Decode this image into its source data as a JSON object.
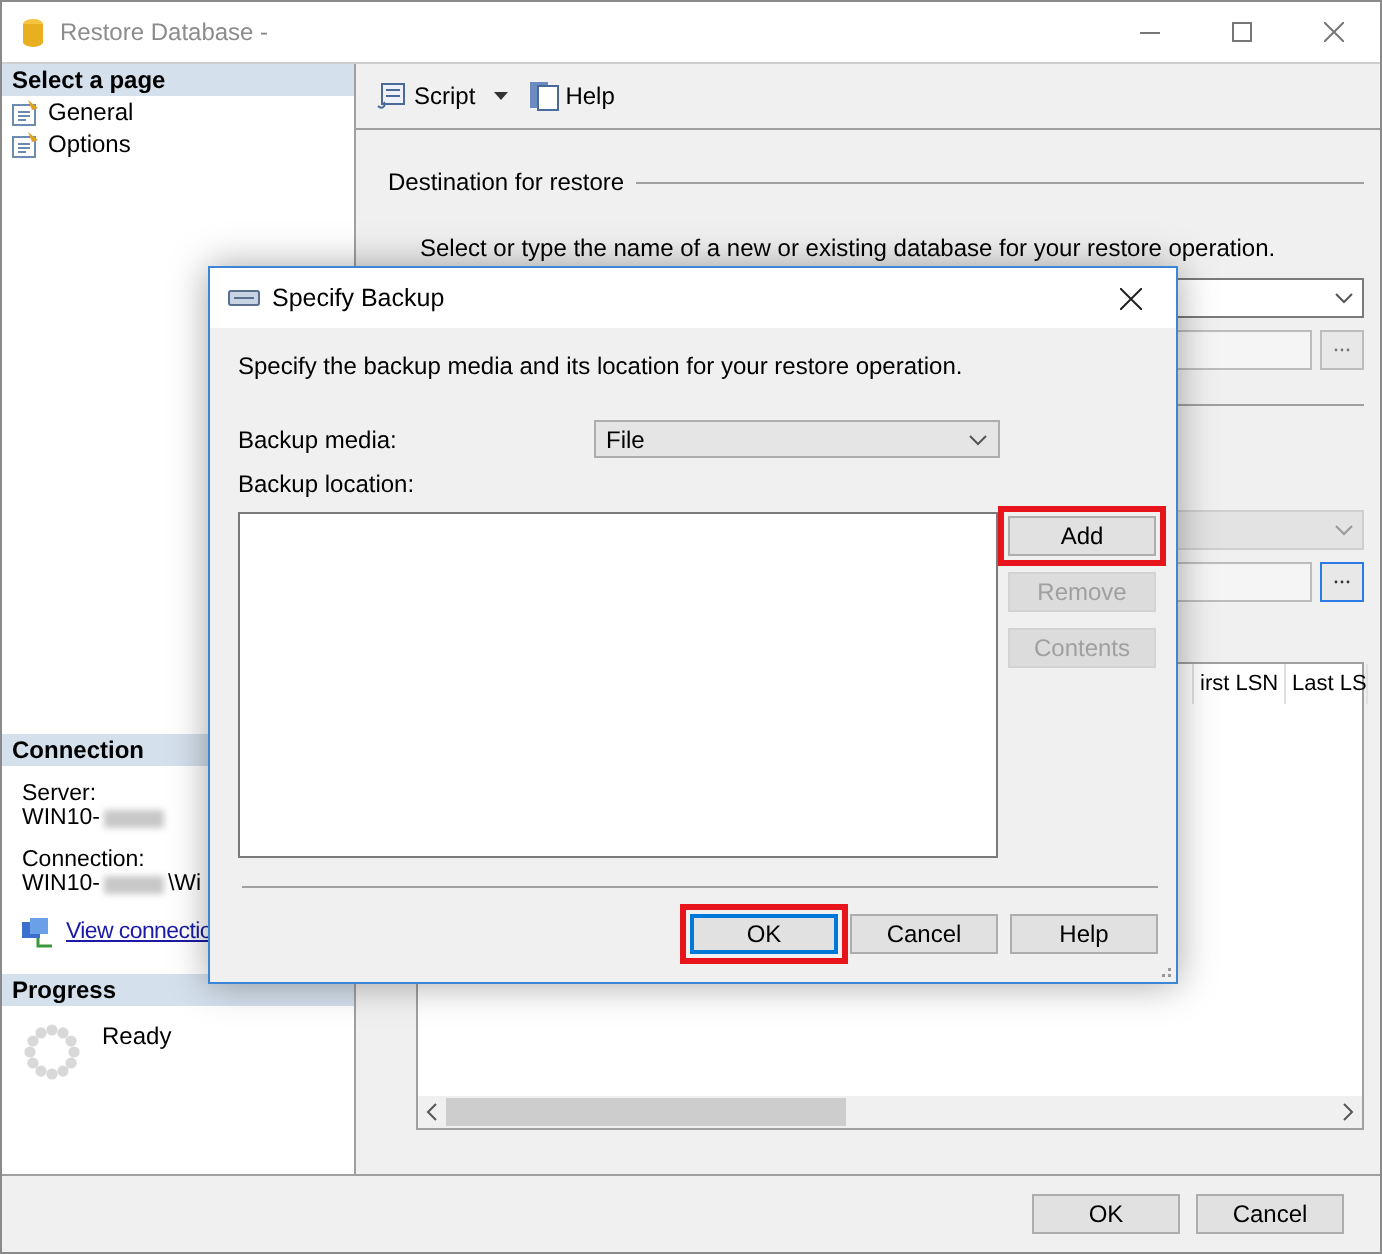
{
  "window": {
    "title": "Restore Database -"
  },
  "sidebar": {
    "header": "Select a page",
    "pages": [
      {
        "label": "General"
      },
      {
        "label": "Options"
      }
    ]
  },
  "connection": {
    "header": "Connection",
    "server_label": "Server:",
    "server_value": "WIN10-",
    "connection_label": "Connection:",
    "connection_value_prefix": "WIN10-",
    "connection_value_suffix": "\\Wi",
    "link": "View connectio"
  },
  "progress": {
    "header": "Progress",
    "status": "Ready"
  },
  "toolbar": {
    "items": [
      {
        "label": "Script",
        "kind": "dropdown"
      },
      {
        "label": "Help",
        "kind": "help"
      }
    ]
  },
  "destination": {
    "legend": "Destination for restore",
    "instruction": "Select or type the name of a new or existing database for your restore operation."
  },
  "grid": {
    "columns": [
      "irst LSN",
      "Last LS"
    ]
  },
  "footer_buttons": [
    "OK",
    "Cancel"
  ],
  "dialog": {
    "title": "Specify Backup",
    "description": "Specify the backup media and its location for your restore operation.",
    "media_label": "Backup media:",
    "media_value": "File",
    "location_label": "Backup location:",
    "side_buttons": [
      {
        "label": "Add",
        "disabled": false,
        "highlighted": true
      },
      {
        "label": "Remove",
        "disabled": true,
        "highlighted": false
      },
      {
        "label": "Contents",
        "disabled": true,
        "highlighted": false
      }
    ],
    "buttons": [
      {
        "label": "OK",
        "highlighted": true,
        "default": true
      },
      {
        "label": "Cancel",
        "highlighted": false,
        "default": false
      },
      {
        "label": "Help",
        "highlighted": false,
        "default": false
      }
    ]
  }
}
